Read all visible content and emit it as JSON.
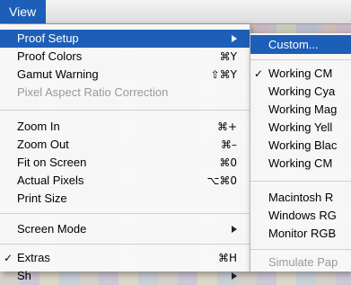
{
  "menubar": {
    "title": "View"
  },
  "view_menu": {
    "items": [
      {
        "label": "Proof Setup"
      },
      {
        "label": "Proof Colors",
        "shortcut": "⌘Y"
      },
      {
        "label": "Gamut Warning",
        "shortcut": "⇧⌘Y"
      },
      {
        "label": "Pixel Aspect Ratio Correction"
      },
      {
        "label": "Zoom In",
        "shortcut": "⌘+"
      },
      {
        "label": "Zoom Out",
        "shortcut": "⌘–"
      },
      {
        "label": "Fit on Screen",
        "shortcut": "⌘0"
      },
      {
        "label": "Actual Pixels",
        "shortcut": "⌥⌘0"
      },
      {
        "label": "Print Size"
      },
      {
        "label": "Screen Mode"
      },
      {
        "label": "Extras",
        "shortcut": "⌘H",
        "check": "✓"
      },
      {
        "label": "Sh"
      }
    ]
  },
  "proof_setup_submenu": {
    "items": [
      {
        "label": "Custom..."
      },
      {
        "label": "Working CM",
        "check": "✓"
      },
      {
        "label": "Working Cya"
      },
      {
        "label": "Working Mag"
      },
      {
        "label": "Working Yell"
      },
      {
        "label": "Working Blac"
      },
      {
        "label": "Working CM"
      },
      {
        "label": "Macintosh R"
      },
      {
        "label": "Windows RG"
      },
      {
        "label": "Monitor RGB"
      },
      {
        "label": "Simulate Pap"
      }
    ]
  }
}
